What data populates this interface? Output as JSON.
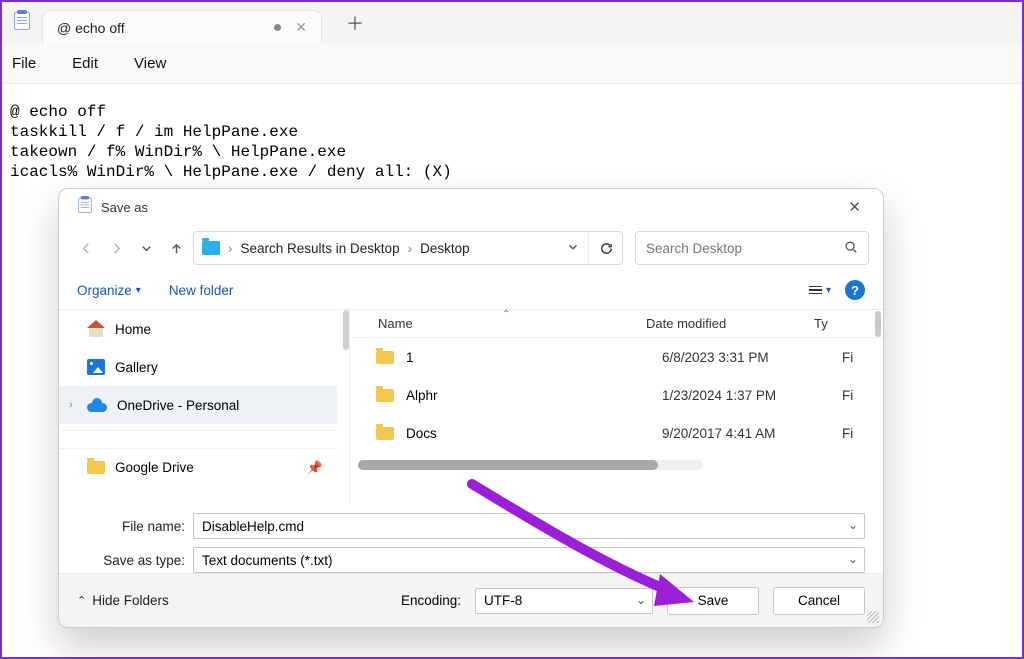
{
  "tab": {
    "title": "@ echo off"
  },
  "menu": {
    "file": "File",
    "edit": "Edit",
    "view": "View"
  },
  "editor_text": "@ echo off\ntaskkill / f / im HelpPane.exe\ntakeown / f% WinDir% \\ HelpPane.exe\nicacls% WinDir% \\ HelpPane.exe / deny all: (X)",
  "dialog": {
    "title": "Save as",
    "breadcrumb": {
      "loc1": "Search Results in Desktop",
      "loc2": "Desktop"
    },
    "search_placeholder": "Search Desktop",
    "organize": "Organize",
    "new_folder": "New folder",
    "sidebar": {
      "home": "Home",
      "gallery": "Gallery",
      "onedrive": "OneDrive - Personal",
      "google_drive": "Google Drive"
    },
    "columns": {
      "name": "Name",
      "date": "Date modified",
      "type": "Ty"
    },
    "rows": [
      {
        "name": "1",
        "date": "6/8/2023 3:31 PM",
        "type": "Fi"
      },
      {
        "name": "Alphr",
        "date": "1/23/2024 1:37 PM",
        "type": "Fi"
      },
      {
        "name": "Docs",
        "date": "9/20/2017 4:41 AM",
        "type": "Fi"
      }
    ],
    "file_name_label": "File name:",
    "file_name_value": "DisableHelp.cmd",
    "save_type_label": "Save as type:",
    "save_type_value": "Text documents (*.txt)",
    "hide_folders": "Hide Folders",
    "encoding_label": "Encoding:",
    "encoding_value": "UTF-8",
    "save": "Save",
    "cancel": "Cancel"
  }
}
